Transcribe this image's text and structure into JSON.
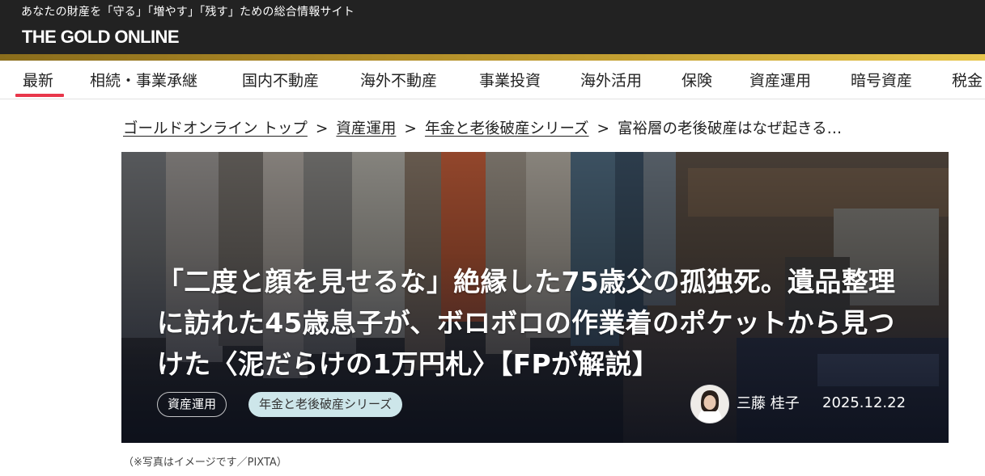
{
  "header": {
    "tagline": "あなたの財産を「守る」「増やす」「残す」ための総合情報サイト",
    "logo": "THE GOLD ONLINE"
  },
  "nav": {
    "items": [
      {
        "label": "最新",
        "active": true
      },
      {
        "label": "相続・事業承継"
      },
      {
        "label": "国内不動産"
      },
      {
        "label": "海外不動産"
      },
      {
        "label": "事業投資"
      },
      {
        "label": "海外活用"
      },
      {
        "label": "保険"
      },
      {
        "label": "資産運用"
      },
      {
        "label": "暗号資産"
      },
      {
        "label": "税金"
      }
    ],
    "active_color": "#e8364a"
  },
  "breadcrumb": {
    "items": [
      "ゴールドオンライン トップ",
      "資産運用",
      "年金と老後破産シリーズ"
    ],
    "current": "富裕層の老後破産はなぜ起きる…",
    "separator": ">"
  },
  "article": {
    "title": "「二度と顔を見せるな」絶縁した75歳父の孤独死。遺品整理に訪れた45歳息子が、ボロボロの作業着のポケットから見つけた〈泥だらけの1万円札〉【FPが解説】",
    "tags": [
      "資産運用",
      "年金と老後破産シリーズ"
    ],
    "author": "三藤 桂子",
    "date": "2025.12.22",
    "image_caption": "（※写真はイメージです／PIXTA）"
  },
  "colors": {
    "topbar": "#222222",
    "gold_accent": "#c6a233",
    "tag_filled_bg": "#cde6ea"
  }
}
